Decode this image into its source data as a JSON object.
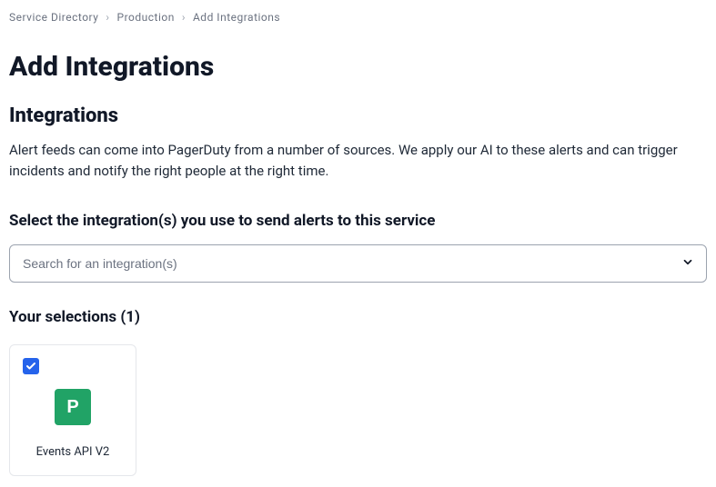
{
  "breadcrumb": {
    "items": [
      "Service Directory",
      "Production",
      "Add Integrations"
    ]
  },
  "page": {
    "title": "Add Integrations",
    "section_title": "Integrations",
    "description": "Alert feeds can come into PagerDuty from a number of sources. We apply our AI to these alerts and can trigger incidents and notify the right people at the right time.",
    "select_heading": "Select the integration(s) you use to send alerts to this service"
  },
  "search": {
    "placeholder": "Search for an integration(s)"
  },
  "selections": {
    "heading": "Your selections (1)",
    "items": [
      {
        "logo_letter": "P",
        "label": "Events API V2",
        "checked": true
      }
    ]
  },
  "colors": {
    "accent": "#2563eb",
    "logo_bg": "#21a366"
  }
}
